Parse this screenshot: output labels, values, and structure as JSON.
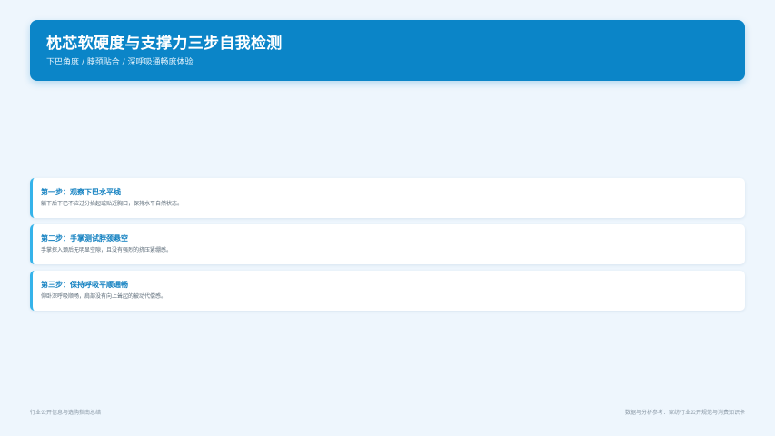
{
  "header": {
    "title": "枕芯软硬度与支撑力三步自我检测",
    "subtitle": "下巴角度 / 脖颈贴合 / 深呼吸通畅度体验"
  },
  "steps": [
    {
      "title": "第一步：观察下巴水平线",
      "description": "躺下后下巴不应过分抬起或贴近胸口，保持水平自然状态。"
    },
    {
      "title": "第二步：手掌测试脖颈悬空",
      "description": "手掌探入颈后无明显空隙，且没有强烈的挤压紧绷感。"
    },
    {
      "title": "第三步：保持呼吸平顺通畅",
      "description": "仰卧深呼吸顺畅，肩部没有向上耸起的被动代偿感。"
    }
  ],
  "footer": {
    "left": "行业公开信息与选购指南总结",
    "right": "数据与分析参考：家纺行业公开规范与消费知识卡"
  },
  "colors": {
    "header_bg": "#0b85c8",
    "accent": "#35b3ea",
    "step_title": "#0c7dbf",
    "page_bg": "#eef6fd"
  }
}
